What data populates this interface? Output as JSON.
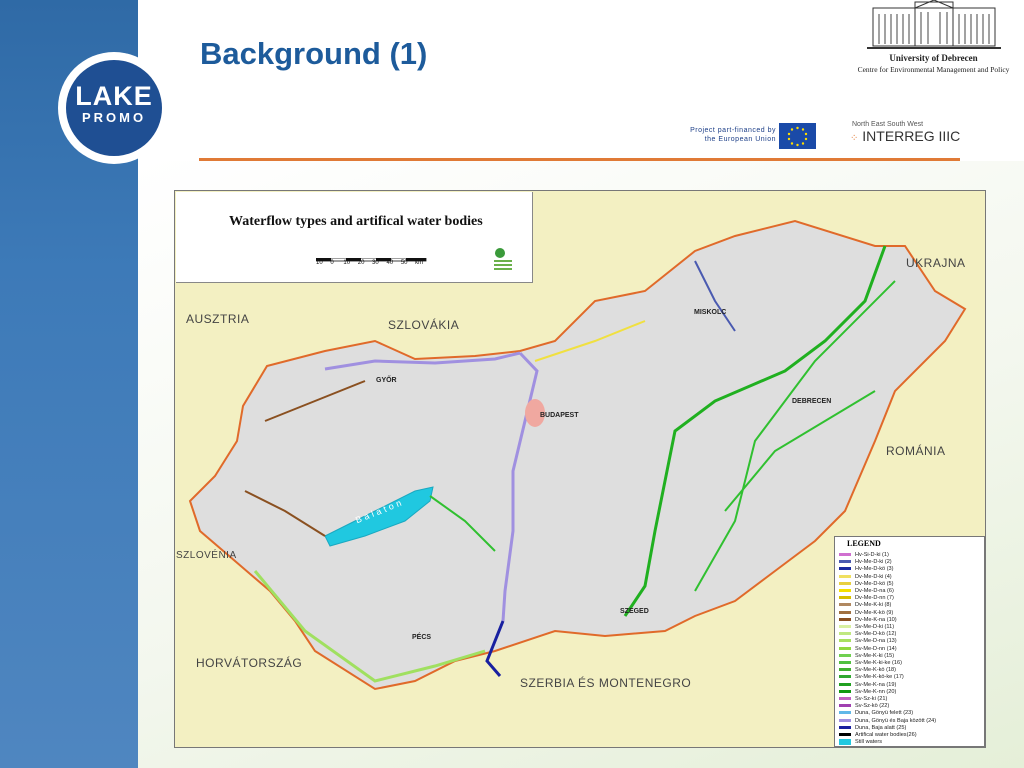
{
  "slide": {
    "title": "Background (1)",
    "logo": {
      "line1": "LAKE",
      "line2": "PROMO"
    },
    "university": {
      "name": "University of Debrecen",
      "centre": "Centre for Environmental Management and Policy"
    },
    "eu_text": "Project part-financed by the European Union",
    "interreg": {
      "top": "North East South West",
      "name": "INTERREG IIIC"
    },
    "accent_color": "#e07a36",
    "brand_color": "#1d5b9b"
  },
  "map": {
    "title": "Waterflow types and artifical water bodies",
    "scale": {
      "ticks": [
        "10",
        "0",
        "10",
        "20",
        "30",
        "40",
        "50"
      ],
      "unit": "km"
    },
    "countries": [
      "AUSZTRIA",
      "SZLOVÁKIA",
      "UKRAJNA",
      "ROMÁNIA",
      "SZLOVÉNIA",
      "HORVÁTORSZÁG",
      "SZERBIA ÉS MONTENEGRO"
    ],
    "cities": [
      "MISKOLC",
      "GYŐR",
      "BUDAPEST",
      "DEBRECEN",
      "PÉCS",
      "SZEGED"
    ],
    "lake": "Balaton",
    "legend": {
      "title": "LEGEND",
      "items": [
        {
          "label": "Hv-Si-D-ki (1)",
          "color": "#d070d0"
        },
        {
          "label": "Hv-Me-D-ki  (2)",
          "color": "#4a5ab0"
        },
        {
          "label": "Hv-Me-D-kö (3)",
          "color": "#1a2aa0"
        },
        {
          "label": "Dv-Me-D-ki (4)",
          "color": "#f0e060"
        },
        {
          "label": "Dv-Me-D-kö (5)",
          "color": "#e8d040"
        },
        {
          "label": "Dv-Me-D-na (6)",
          "color": "#f5e000"
        },
        {
          "label": "Dv-Me-D-nn (7)",
          "color": "#d8c000"
        },
        {
          "label": "Dv-Me-K-ki (8)",
          "color": "#b08860"
        },
        {
          "label": "Dv-Me-K-kö (9)",
          "color": "#a07040"
        },
        {
          "label": "Dv-Me-K-na (10)",
          "color": "#8a5020"
        },
        {
          "label": "Sv-Me-D-ki (11)",
          "color": "#d8f0a0"
        },
        {
          "label": "Sv-Me-D-kö (12)",
          "color": "#c0e880"
        },
        {
          "label": "Sv-Me-D-na (13)",
          "color": "#a8e060"
        },
        {
          "label": "Sv-Me-D-nn (14)",
          "color": "#90d840"
        },
        {
          "label": "Sv-Me-K-ki (15)",
          "color": "#70d050"
        },
        {
          "label": "Sv-Me-K-ki-ke (16)",
          "color": "#50c040"
        },
        {
          "label": "Sv-Me-K-kö (18)",
          "color": "#40b030"
        },
        {
          "label": "Sv-Me-K-kö-ke (17)",
          "color": "#30a830"
        },
        {
          "label": "Sv-Me-K-na (19)",
          "color": "#20a020"
        },
        {
          "label": "Sv-Me-K-nn (20)",
          "color": "#109810"
        },
        {
          "label": "Sv-Sz-ki (21)",
          "color": "#c060c0"
        },
        {
          "label": "Sv-Sz-kö (22)",
          "color": "#a040b0"
        },
        {
          "label": "Duna, Gönyü felett (23)",
          "color": "#60b8e8"
        },
        {
          "label": "Duna, Gönyü és Baja között (24)",
          "color": "#a090e0"
        },
        {
          "label": "Duna, Baja alatt (25)",
          "color": "#1820a0"
        },
        {
          "label": "Artifical water bodies(26)",
          "color": "#000000"
        },
        {
          "label": "Still waters",
          "color": "#20c8e0"
        }
      ]
    }
  }
}
